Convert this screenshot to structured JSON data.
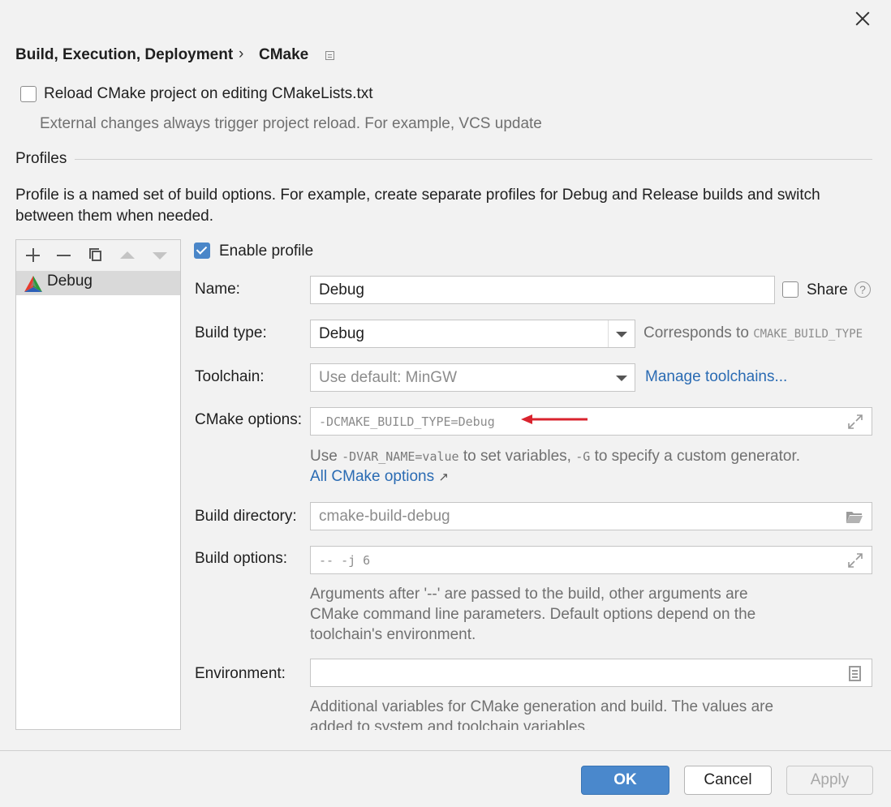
{
  "breadcrumb": {
    "parent": "Build, Execution, Deployment",
    "separator": "›",
    "current": "CMake"
  },
  "reload": {
    "label": "Reload CMake project on editing CMakeLists.txt",
    "checked": false,
    "hint": "External changes always trigger project reload. For example, VCS update"
  },
  "profiles": {
    "section_title": "Profiles",
    "description": "Profile is a named set of build options. For example, create separate profiles for Debug and Release builds and switch between them when needed.",
    "items": [
      "Debug"
    ],
    "selected": "Debug"
  },
  "form": {
    "enable_profile_label": "Enable profile",
    "enable_profile_checked": true,
    "name_label": "Name:",
    "name_value": "Debug",
    "share_label": "Share",
    "help_glyph": "?",
    "build_type_label": "Build type:",
    "build_type_value": "Debug",
    "build_type_note": "Corresponds to",
    "build_type_note_code": "CMAKE_BUILD_TYPE",
    "toolchain_label": "Toolchain:",
    "toolchain_value": "Use default: MinGW",
    "manage_toolchains": "Manage toolchains...",
    "cmake_options_label": "CMake options:",
    "cmake_options_value": "-DCMAKE_BUILD_TYPE=Debug",
    "cmake_hint_use": "Use",
    "cmake_hint_code1": "-DVAR_NAME=value",
    "cmake_hint_mid": "to set variables,",
    "cmake_hint_code2": "-G",
    "cmake_hint_end": "to specify a custom generator.",
    "all_cmake_options": "All CMake options",
    "all_cmake_options_arrow": "↗",
    "build_dir_label": "Build directory:",
    "build_dir_value": "cmake-build-debug",
    "build_options_label": "Build options:",
    "build_options_value": "-- -j 6",
    "build_options_hint_1": "Arguments after '--' are passed to the build, other arguments are",
    "build_options_hint_2": "CMake command line parameters. Default options depend on the",
    "build_options_hint_3": "toolchain's environment.",
    "environment_label": "Environment:",
    "environment_value": "",
    "environment_hint_1": "Additional variables for CMake generation and build. The values are",
    "environment_hint_2": "added to system and toolchain variables."
  },
  "buttons": {
    "ok": "OK",
    "cancel": "Cancel",
    "apply": "Apply"
  },
  "colors": {
    "accent": "#4a88cc",
    "link": "#2a6bb3",
    "annotation_arrow": "#d9232e"
  }
}
